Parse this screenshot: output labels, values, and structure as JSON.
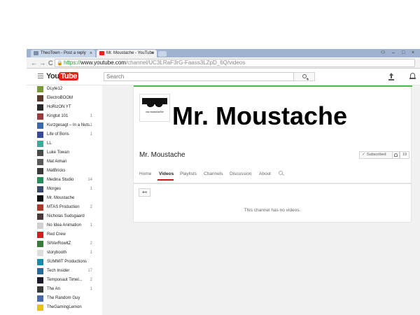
{
  "browser": {
    "tabs": [
      {
        "title": "TheoTown - Post a reply",
        "close": "×"
      },
      {
        "title": "Mr. Moustache - YouTube",
        "close": "×"
      }
    ],
    "url": {
      "scheme": "https://",
      "host": "www.youtube.com",
      "path": "/channel/UC3LRaF3rG-Faass3LZpD_6Q/videos"
    },
    "nav": {
      "back": "←",
      "forward": "→",
      "reload": "C"
    }
  },
  "masthead": {
    "logo_you": "You",
    "logo_tube": "Tube",
    "logo_region": "MY",
    "search_placeholder": "Search"
  },
  "sidebar": {
    "subscriptions": [
      {
        "name": "DLyte12",
        "count": "",
        "color": "#7a9a3a"
      },
      {
        "name": "ElectroBOOM",
        "count": "",
        "color": "#5a3a2a"
      },
      {
        "name": "HoRizON YT",
        "count": "",
        "color": "#2a2a2a"
      },
      {
        "name": "Kingtut 101",
        "count": "1",
        "color": "#9a3a3a"
      },
      {
        "name": "Kurzgesagt – In a Nuts...",
        "count": "1",
        "color": "#3a6aaa"
      },
      {
        "name": "Life of Boris",
        "count": "1",
        "color": "#3a4a9a"
      },
      {
        "name": "LL",
        "count": "",
        "color": "#3aaa9a"
      },
      {
        "name": "Luke Towan",
        "count": "",
        "color": "#4a4a4a"
      },
      {
        "name": "Mat Aiman",
        "count": "",
        "color": "#5a5a5a"
      },
      {
        "name": "MatBricks",
        "count": "",
        "color": "#3a3a3a"
      },
      {
        "name": "Medina Studio",
        "count": "14",
        "color": "#2a8a5a"
      },
      {
        "name": "Morges",
        "count": "1",
        "color": "#3a4a6a"
      },
      {
        "name": "Mr. Moustache",
        "count": "",
        "color": "#111111"
      },
      {
        "name": "MTAS Production",
        "count": "2",
        "color": "#aa3a2a"
      },
      {
        "name": "Nicholas Sudsgaard",
        "count": "",
        "color": "#4a3a3a"
      },
      {
        "name": "No Idea Animation",
        "count": "1",
        "color": "#d0d0d0"
      },
      {
        "name": "Red Crew",
        "count": "",
        "color": "#cc2222"
      },
      {
        "name": "SilVerRowitZ",
        "count": "2",
        "color": "#3a7a3a"
      },
      {
        "name": "storybooth",
        "count": "1",
        "color": "#dddddd"
      },
      {
        "name": "SUMMIT Productions",
        "count": "",
        "color": "#1a8aaa"
      },
      {
        "name": "Tech Insider",
        "count": "17",
        "color": "#2a6a9a"
      },
      {
        "name": "Temponaut Timel...",
        "count": "2",
        "color": "#1a1a2a"
      },
      {
        "name": "The An",
        "count": "1",
        "color": "#3a3a3a"
      },
      {
        "name": "The Random Guy",
        "count": "",
        "color": "#4a6aaa"
      },
      {
        "name": "TheGamingLemon",
        "count": "",
        "color": "#e8c020"
      }
    ]
  },
  "channel": {
    "banner_title": "Mr. Moustache",
    "thumb_label": "mr moustache",
    "name": "Mr. Moustache",
    "subscribe_label": "Subscribed",
    "subscriber_count": "19",
    "tabs": [
      "Home",
      "Videos",
      "Playlists",
      "Channels",
      "Discussion",
      "About"
    ],
    "active_tab": "Videos",
    "back_label": "↤",
    "empty_message": "This channel has no videos."
  },
  "colors": {
    "accent": "#cc181e",
    "banner_line": "#52b94a",
    "secure": "#2a9a2a"
  }
}
